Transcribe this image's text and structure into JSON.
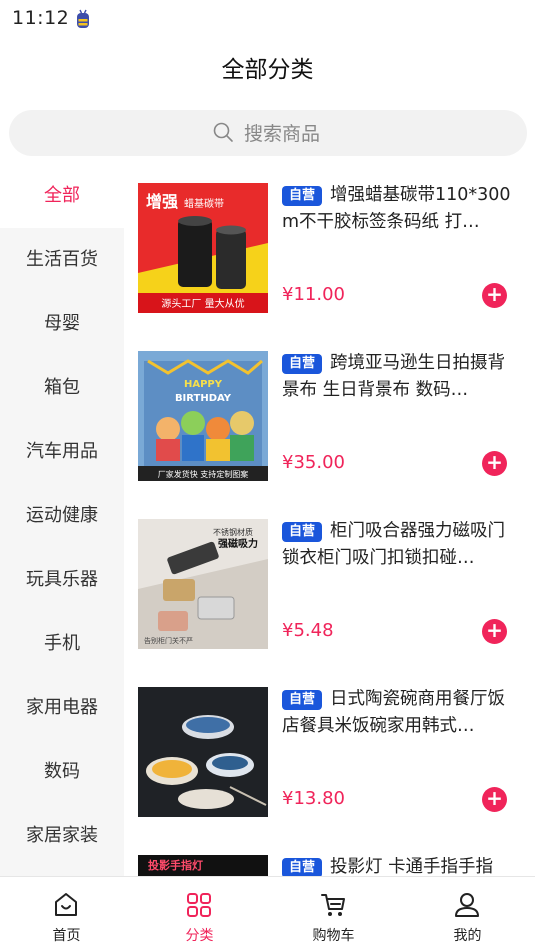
{
  "status_bar": {
    "time": "11:12"
  },
  "header": {
    "title": "全部分类"
  },
  "search": {
    "placeholder": "搜索商品"
  },
  "sidebar": {
    "items": [
      {
        "label": "全部",
        "active": true
      },
      {
        "label": "生活百货",
        "active": false
      },
      {
        "label": "母婴",
        "active": false
      },
      {
        "label": "箱包",
        "active": false
      },
      {
        "label": "汽车用品",
        "active": false
      },
      {
        "label": "运动健康",
        "active": false
      },
      {
        "label": "玩具乐器",
        "active": false
      },
      {
        "label": "手机",
        "active": false
      },
      {
        "label": "家用电器",
        "active": false
      },
      {
        "label": "数码",
        "active": false
      },
      {
        "label": "家居家装",
        "active": false
      }
    ]
  },
  "products": [
    {
      "badge": "自营",
      "title": "增强蜡基碳带110*300m不干胶标签条码纸 打…",
      "price": "¥11.00",
      "image_text": {
        "headline": "增强",
        "sub": "蜡基碳带",
        "footer": "源头工厂 量大从优"
      }
    },
    {
      "badge": "自营",
      "title": "跨境亚马逊生日拍摄背景布 生日背景布 数码…",
      "price": "¥35.00",
      "image_text": {
        "headline": "HAPPY",
        "sub": "BIRTHDAY",
        "footer": "厂家发货快 支持定制图案"
      }
    },
    {
      "badge": "自营",
      "title": "柜门吸合器强力磁吸门锁衣柜门吸门扣锁扣碰…",
      "price": "¥5.48",
      "image_text": {
        "headline": "不锈钢材质",
        "sub": "强磁吸力",
        "footer": "告别柜门关不严"
      }
    },
    {
      "badge": "自营",
      "title": "日式陶瓷碗商用餐厅饭店餐具米饭碗家用韩式…",
      "price": "¥13.80"
    },
    {
      "badge": "自营",
      "title": "投影灯 卡通手指手指",
      "price": "",
      "image_text": {
        "headline": "投影手指灯"
      }
    }
  ],
  "tabbar": {
    "items": [
      {
        "label": "首页",
        "icon": "home-icon",
        "active": false
      },
      {
        "label": "分类",
        "icon": "grid-icon",
        "active": true
      },
      {
        "label": "购物车",
        "icon": "cart-icon",
        "active": false
      },
      {
        "label": "我的",
        "icon": "user-icon",
        "active": false
      }
    ]
  },
  "colors": {
    "accent": "#f0245a",
    "badge": "#1a56db",
    "sidebar_bg": "#f6f6f6"
  }
}
